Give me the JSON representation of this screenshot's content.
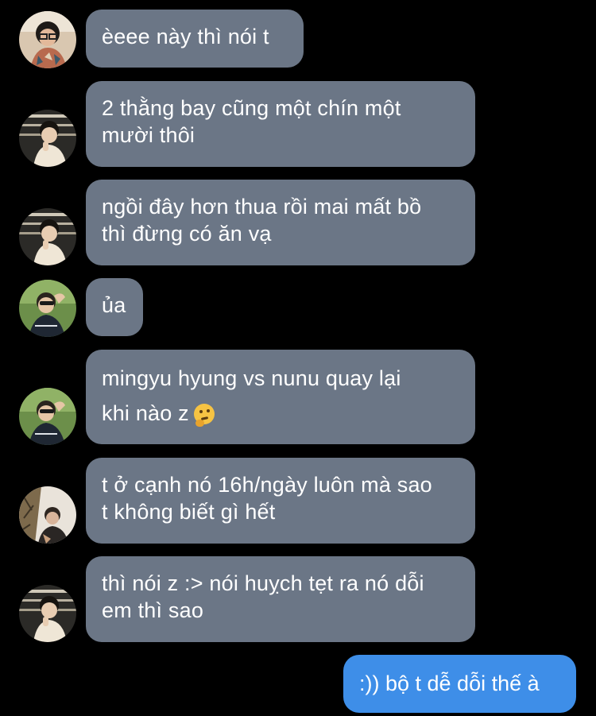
{
  "messages": [
    {
      "sender": "friend-a",
      "lines": [
        "èeee này thì nói t"
      ]
    },
    {
      "sender": "friend-b",
      "lines": [
        "2 thằng bay cũng một chín một",
        "mười thôi"
      ]
    },
    {
      "sender": "friend-b",
      "lines": [
        "ngồi đây hơn thua rồi mai mất bồ",
        "thì đừng có ăn vạ"
      ]
    },
    {
      "sender": "friend-c",
      "lines": [
        "ủa"
      ]
    },
    {
      "sender": "friend-c",
      "lines": [
        "mingyu hyung vs nunu quay lại",
        "khi nào z"
      ],
      "emoji": "thinking-face"
    },
    {
      "sender": "friend-d",
      "lines": [
        "t ở cạnh nó 16h/ngày luôn mà sao",
        "t không biết gì hết"
      ]
    },
    {
      "sender": "friend-b",
      "lines": [
        "thì nói z :> nói huỵch tẹt ra nó dỗi",
        "em thì sao"
      ]
    }
  ],
  "outgoing": {
    "text": ":)) bộ t dễ dỗi thế à"
  },
  "colors": {
    "background": "#000000",
    "incoming_bubble": "#6b7686",
    "outgoing_bubble": "#3e8ee8",
    "text": "#ffffff"
  }
}
